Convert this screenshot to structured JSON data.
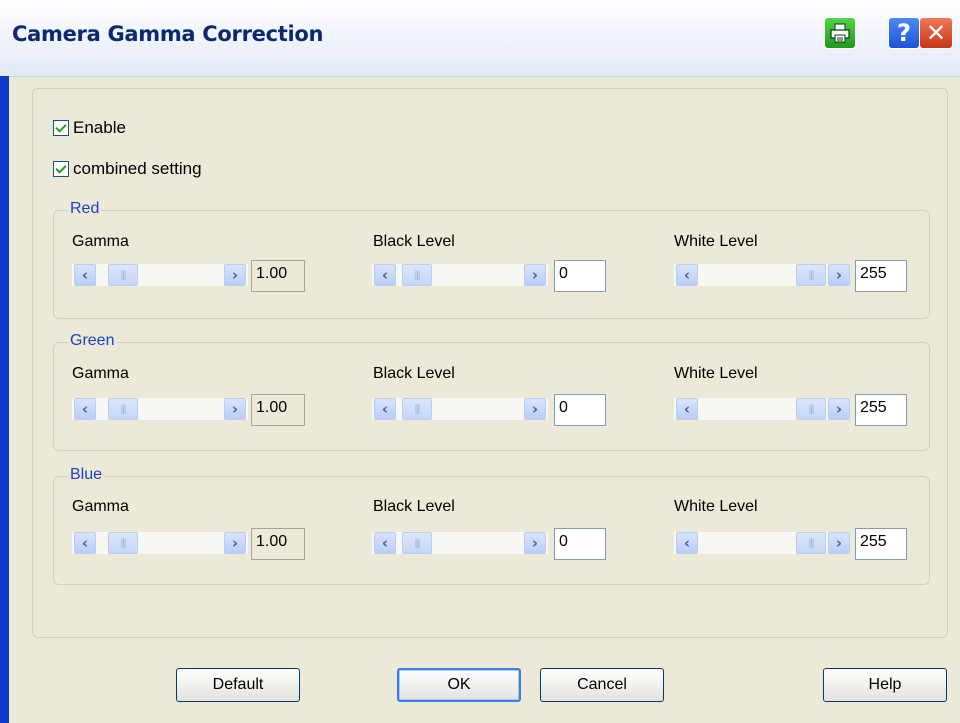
{
  "window": {
    "title": "Camera Gamma Correction",
    "help_glyph": "?",
    "close_glyph": "✕"
  },
  "options": {
    "enable_label": "Enable",
    "enable_checked": true,
    "combined_label": "combined setting",
    "combined_checked": true
  },
  "channels": [
    {
      "name": "Red",
      "gamma_label": "Gamma",
      "gamma_value": "1.00",
      "black_label": "Black Level",
      "black_value": "0",
      "white_label": "White Level",
      "white_value": "255"
    },
    {
      "name": "Green",
      "gamma_label": "Gamma",
      "gamma_value": "1.00",
      "black_label": "Black Level",
      "black_value": "0",
      "white_label": "White Level",
      "white_value": "255"
    },
    {
      "name": "Blue",
      "gamma_label": "Gamma",
      "gamma_value": "1.00",
      "black_label": "Black Level",
      "black_value": "0",
      "white_label": "White Level",
      "white_value": "255"
    }
  ],
  "buttons": {
    "default": "Default",
    "ok": "OK",
    "cancel": "Cancel",
    "help": "Help"
  },
  "colors": {
    "dialog_bg": "#ECE9D8",
    "group_label": "#1843C8",
    "title_text": "#0B2A6E"
  }
}
